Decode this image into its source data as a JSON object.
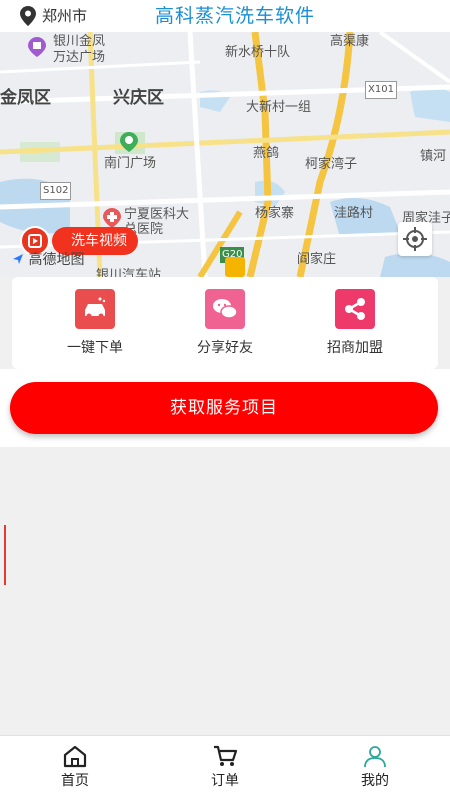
{
  "header": {
    "city": "郑州市",
    "title": "高科蒸汽洗车软件"
  },
  "map": {
    "labels": [
      "银川金凤",
      "万达广场",
      "新水桥十队",
      "高渠康",
      "金凤区",
      "兴庆区",
      "X101",
      "大新村一组",
      "南门广场",
      "燕鸽",
      "柯家湾子",
      "镇河",
      "S102",
      "宁夏医科大",
      "总医院",
      "杨家寨",
      "洼路村",
      "周家洼子",
      "G20",
      "阎家庄",
      "高德地图",
      "银川汽车站"
    ],
    "video_label": "洗车视频"
  },
  "actions": [
    {
      "label": "一键下单",
      "color": "#ea4d4d",
      "icon": "car-wash-icon"
    },
    {
      "label": "分享好友",
      "color": "#f06292",
      "icon": "wechat-icon"
    },
    {
      "label": "招商加盟",
      "color": "#ee3a6b",
      "icon": "share-icon"
    }
  ],
  "primary_button": "获取服务项目",
  "tabs": [
    {
      "label": "首页",
      "icon": "home-icon"
    },
    {
      "label": "订单",
      "icon": "cart-icon"
    },
    {
      "label": "我的",
      "icon": "user-icon",
      "active": true
    }
  ],
  "colors": {
    "title": "#1a8fd6",
    "primary": "#ff0000",
    "pill": "#f0321e"
  }
}
